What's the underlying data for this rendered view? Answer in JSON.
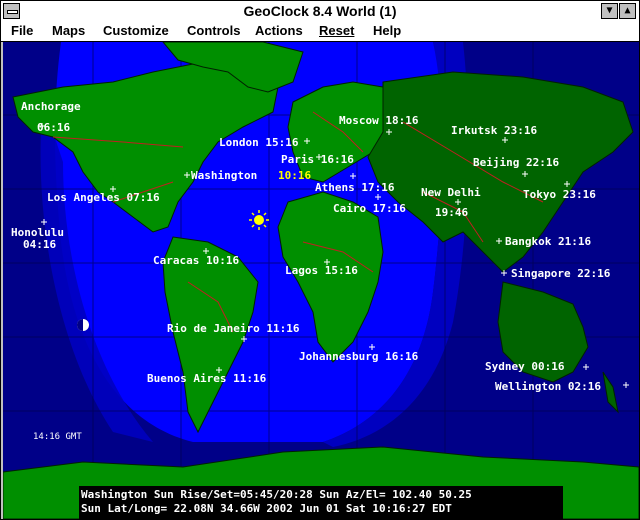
{
  "app": {
    "title": "GeoClock 8.4     World  (1)"
  },
  "menu": {
    "file": "File",
    "maps": "Maps",
    "customize": "Customize",
    "controls": "Controls",
    "actions": "Actions",
    "reset": "Reset",
    "help": "Help"
  },
  "cities": [
    {
      "label": "Anchorage"
    },
    {
      "label": "06:16"
    },
    {
      "label": "Los Angeles 07:16"
    },
    {
      "label": "Honolulu"
    },
    {
      "label": "04:16"
    },
    {
      "label": "Washington"
    },
    {
      "label": "10:16"
    },
    {
      "label": "London 15:16"
    },
    {
      "label": "Paris 16:16"
    },
    {
      "label": "Moscow 18:16"
    },
    {
      "label": "Irkutsk 23:16"
    },
    {
      "label": "Beijing 22:16"
    },
    {
      "label": "Tokyo 23:16"
    },
    {
      "label": "Athens 17:16"
    },
    {
      "label": "Cairo 17:16"
    },
    {
      "label": "New Delhi"
    },
    {
      "label": "19:46"
    },
    {
      "label": "Bangkok 21:16"
    },
    {
      "label": "Singapore 22:16"
    },
    {
      "label": "Caracas 10:16"
    },
    {
      "label": "Lagos 15:16"
    },
    {
      "label": "Rio de Janeiro 11:16"
    },
    {
      "label": "Johannesburg 16:16"
    },
    {
      "label": "Buenos Aires 11:16"
    },
    {
      "label": "Sydney 00:16"
    },
    {
      "label": "Wellington 02:16"
    }
  ],
  "gmt_label": "14:16 GMT",
  "status": {
    "line1": "Washington Sun Rise/Set=05:45/20:28  Sun Az/El= 102.40  50.25",
    "line2": "Sun Lat/Long=  22.08N  34.66W   2002 Jun 01 Sat 10:16:27 EDT"
  },
  "colors": {
    "ocean_day": "#0000ff",
    "ocean_night": "#000088",
    "land_day": "#008f00",
    "land_night": "#006400",
    "borders": "#c02020",
    "label_text": "#ffffff",
    "highlight_text": "#ffff00",
    "status_bg": "#000000"
  }
}
